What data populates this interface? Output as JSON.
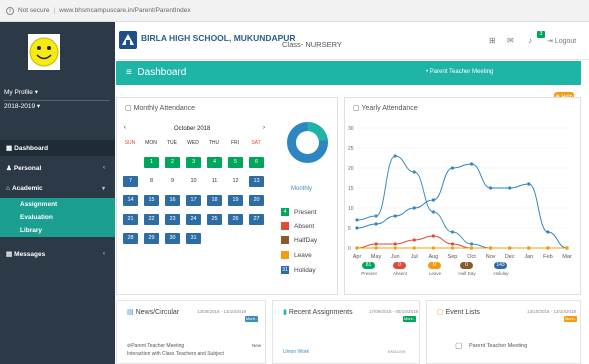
{
  "browser": {
    "security": "Not secure",
    "url": "www.bhsmcampuscare.in/Parent/ParentIndex"
  },
  "sidebar": {
    "profile": "My Profile",
    "year": "2018-2019",
    "items": [
      {
        "label": "Dashboard"
      },
      {
        "label": "Personal"
      },
      {
        "label": "Academic"
      },
      {
        "label": "Messages"
      }
    ],
    "subitems": [
      {
        "label": "Assignment"
      },
      {
        "label": "Evaluation"
      },
      {
        "label": "Library"
      }
    ]
  },
  "header": {
    "school": "BIRLA HIGH SCHOOL, MUKUNDAPUR",
    "class": "Class- NURSERY",
    "notif_count": "3",
    "logout": "Logout"
  },
  "dashbar": {
    "title": "Dashboard",
    "notice": "Parent Teacher Meeting",
    "help": "Help"
  },
  "monthly": {
    "title": "Monthly Attendance",
    "month": "October 2018",
    "prev": "‹",
    "next": "›",
    "weekdays": [
      "SUN",
      "MON",
      "TUE",
      "WED",
      "THU",
      "FRI",
      "SAT"
    ],
    "donut_label": "Monthly",
    "legend": [
      {
        "count": "4",
        "label": "Present",
        "color": "#00a65a"
      },
      {
        "count": "",
        "label": "Absent",
        "color": "#dd4b39"
      },
      {
        "count": "",
        "label": "HalfDay",
        "color": "#8b5a2b"
      },
      {
        "count": "",
        "label": "Leave",
        "color": "#f39c12"
      },
      {
        "count": "31",
        "label": "Holiday",
        "color": "#2e6da4"
      }
    ]
  },
  "yearly": {
    "title": "Yearly Attendance",
    "pills": [
      {
        "value": "81",
        "label": "Present",
        "color": "#00a65a"
      },
      {
        "value": "0",
        "label": "Absent",
        "color": "#dd4b39"
      },
      {
        "value": "0",
        "label": "Leave",
        "color": "#f39c12"
      },
      {
        "value": "0",
        "label": "Half Day",
        "color": "#8b5a2b"
      },
      {
        "value": "143",
        "label": "Holiday",
        "color": "#2e6da4"
      }
    ]
  },
  "chart_data": {
    "type": "line",
    "title": "",
    "categories": [
      "Apr",
      "May",
      "Jun",
      "Jul",
      "Aug",
      "Sep",
      "Oct",
      "Nov",
      "Dec",
      "Jan",
      "Feb",
      "Mar"
    ],
    "ylim": [
      0,
      30
    ],
    "yticks": [
      0,
      5,
      10,
      15,
      20,
      25,
      30
    ],
    "grid": true,
    "series": [
      {
        "color": "#3c8dbc",
        "values": [
          7,
          8,
          23,
          19,
          9,
          4,
          1,
          0,
          0,
          0,
          0,
          0
        ]
      },
      {
        "color": "#2e86c1",
        "values": [
          5,
          6,
          8,
          10,
          12,
          20,
          21,
          15,
          15,
          16,
          4,
          0
        ]
      },
      {
        "color": "#dd4b39",
        "values": [
          0,
          1,
          1,
          2,
          3,
          1,
          0,
          0,
          0,
          0,
          0,
          0
        ]
      },
      {
        "color": "#f39c12",
        "values": [
          0,
          0,
          0,
          0,
          0,
          0,
          0,
          0,
          0,
          0,
          0,
          0
        ]
      }
    ]
  },
  "cards": [
    {
      "title": "News/Circular",
      "dates": "13/05/2018 - 13/10/2018",
      "more": "More..",
      "line1": "Parent Teacher Meeting",
      "tag": "New",
      "line2": "Interaction with Class Teachers and Subject"
    },
    {
      "title": "Recent Assignments",
      "dates": "17/09/2018 - 05/10/2018",
      "more": "More..",
      "line1": "Union Work",
      "tag": "ENGLISH"
    },
    {
      "title": "Event Lists",
      "dates": "13/10/2018 - 13/10/2018",
      "more": "More..",
      "line1": "Parent Teacher Meeting"
    }
  ],
  "calendar_days": [
    {
      "d": "1",
      "c": 1,
      "r": 0,
      "col": "#00a65a"
    },
    {
      "d": "2",
      "c": 2,
      "r": 0,
      "col": "#00a65a"
    },
    {
      "d": "3",
      "c": 3,
      "r": 0,
      "col": "#00a65a"
    },
    {
      "d": "4",
      "c": 4,
      "r": 0,
      "col": "#00a65a"
    },
    {
      "d": "5",
      "c": 5,
      "r": 0,
      "col": "#00a65a"
    },
    {
      "d": "6",
      "c": 6,
      "r": 0,
      "col": "#00a65a"
    },
    {
      "d": "7",
      "c": 0,
      "r": 1,
      "col": "#2e6da4"
    },
    {
      "d": "8",
      "c": 1,
      "r": 1,
      "col": "#ffffff"
    },
    {
      "d": "9",
      "c": 2,
      "r": 1,
      "col": "#ffffff"
    },
    {
      "d": "10",
      "c": 3,
      "r": 1,
      "col": "#ffffff"
    },
    {
      "d": "11",
      "c": 4,
      "r": 1,
      "col": "#ffffff"
    },
    {
      "d": "12",
      "c": 5,
      "r": 1,
      "col": "#ffffff"
    },
    {
      "d": "13",
      "c": 6,
      "r": 1,
      "col": "#2e6da4"
    },
    {
      "d": "14",
      "c": 0,
      "r": 2,
      "col": "#2e6da4"
    },
    {
      "d": "15",
      "c": 1,
      "r": 2,
      "col": "#2e6da4"
    },
    {
      "d": "16",
      "c": 2,
      "r": 2,
      "col": "#2e6da4"
    },
    {
      "d": "17",
      "c": 3,
      "r": 2,
      "col": "#2e6da4"
    },
    {
      "d": "18",
      "c": 4,
      "r": 2,
      "col": "#2e6da4"
    },
    {
      "d": "19",
      "c": 5,
      "r": 2,
      "col": "#2e6da4"
    },
    {
      "d": "20",
      "c": 6,
      "r": 2,
      "col": "#2e6da4"
    },
    {
      "d": "21",
      "c": 0,
      "r": 3,
      "col": "#2e6da4"
    },
    {
      "d": "22",
      "c": 1,
      "r": 3,
      "col": "#2e6da4"
    },
    {
      "d": "23",
      "c": 2,
      "r": 3,
      "col": "#2e6da4"
    },
    {
      "d": "24",
      "c": 3,
      "r": 3,
      "col": "#2e6da4"
    },
    {
      "d": "25",
      "c": 4,
      "r": 3,
      "col": "#2e6da4"
    },
    {
      "d": "26",
      "c": 5,
      "r": 3,
      "col": "#2e6da4"
    },
    {
      "d": "27",
      "c": 6,
      "r": 3,
      "col": "#2e6da4"
    },
    {
      "d": "28",
      "c": 0,
      "r": 4,
      "col": "#2e6da4"
    },
    {
      "d": "29",
      "c": 1,
      "r": 4,
      "col": "#2e6da4"
    },
    {
      "d": "30",
      "c": 2,
      "r": 4,
      "col": "#2e6da4"
    },
    {
      "d": "31",
      "c": 3,
      "r": 4,
      "col": "#2e6da4"
    }
  ]
}
